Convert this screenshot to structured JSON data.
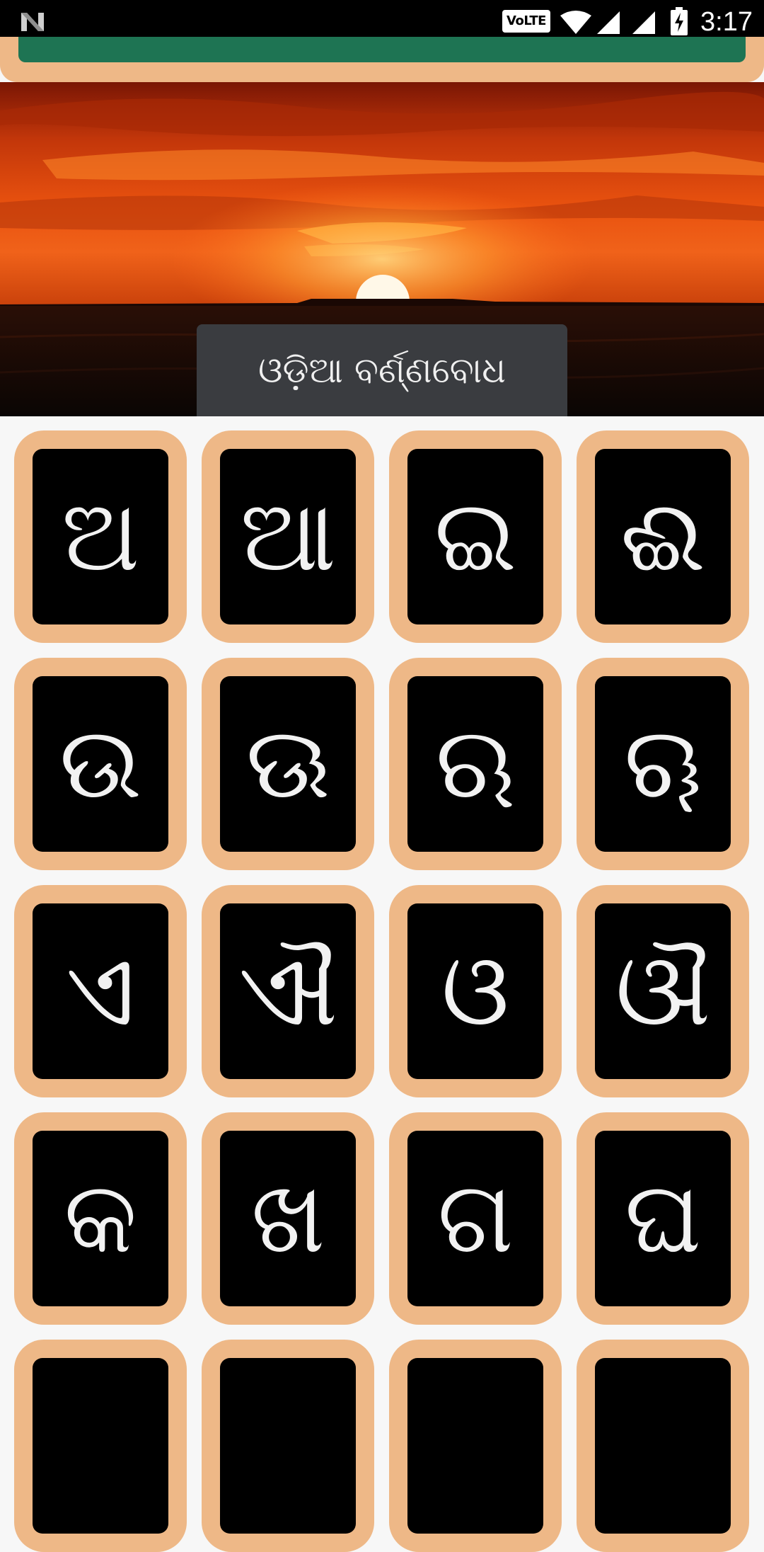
{
  "status_bar": {
    "time": "3:17",
    "volte_label": "VoLTE",
    "icons": [
      "notification-n-icon",
      "volte-icon",
      "wifi-icon",
      "signal-icon",
      "signal-icon",
      "battery-charging-icon"
    ]
  },
  "header": {
    "accent_color": "#1e7453",
    "frame_color": "#eeb887"
  },
  "banner": {
    "image": "sunset-over-sea",
    "title": "ଓଡ଼ିଆ ବର୍ଣ୍ଣବୋଧ"
  },
  "letters": [
    "ଅ",
    "ଆ",
    "ଇ",
    "ଈ",
    "ଉ",
    "ଊ",
    "ଋ",
    "ୠ",
    "ଏ",
    "ଐ",
    "ଓ",
    "ଔ",
    "କ",
    "ଖ",
    "ଗ",
    "ଘ"
  ],
  "colors": {
    "tile_frame": "#eeb887",
    "tile_inner": "#000000",
    "background": "#f7f7f7"
  }
}
